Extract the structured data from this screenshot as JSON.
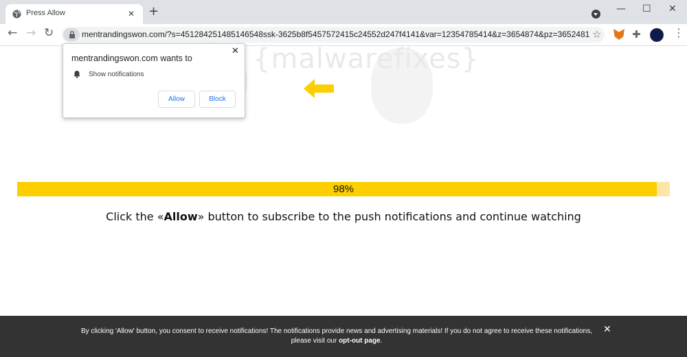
{
  "tab": {
    "title": "Press Allow",
    "close": "✕",
    "new_tab": "+"
  },
  "window": {
    "minimize": "—",
    "maximize": "☐",
    "close": "✕"
  },
  "toolbar": {
    "back": "←",
    "forward": "→",
    "reload": "↻",
    "url": "mentrandingswon.com/?s=451284251485146548ssk-3625b8f5457572415c24552d247f4141&var=12354785414&z=3654874&pz=3652481",
    "star": "☆",
    "puzzle": "✚",
    "menu": "⋮"
  },
  "watermark": "{malwarefixes}",
  "popup": {
    "title": "mentrandingswon.com wants to",
    "permission": "Show notifications",
    "allow_label": "Allow",
    "block_label": "Block",
    "close": "✕"
  },
  "progress": {
    "value": 0.98,
    "label": "98%"
  },
  "message": {
    "before": "Click the «",
    "bold": "Allow",
    "after": "» button to subscribe to the push notifications and continue watching"
  },
  "consent_bar": {
    "text": "By clicking 'Allow' button, you consent to receive notifications! The notifications provide news and advertising materials! If you do not agree to receive these notifications, please visit our ",
    "link": "opt-out page",
    "end": ".",
    "close": "✕"
  },
  "colors": {
    "accent": "#fdcf01",
    "track": "#fce6a6",
    "bar": "#333333",
    "link_blue": "#1a73e8"
  }
}
